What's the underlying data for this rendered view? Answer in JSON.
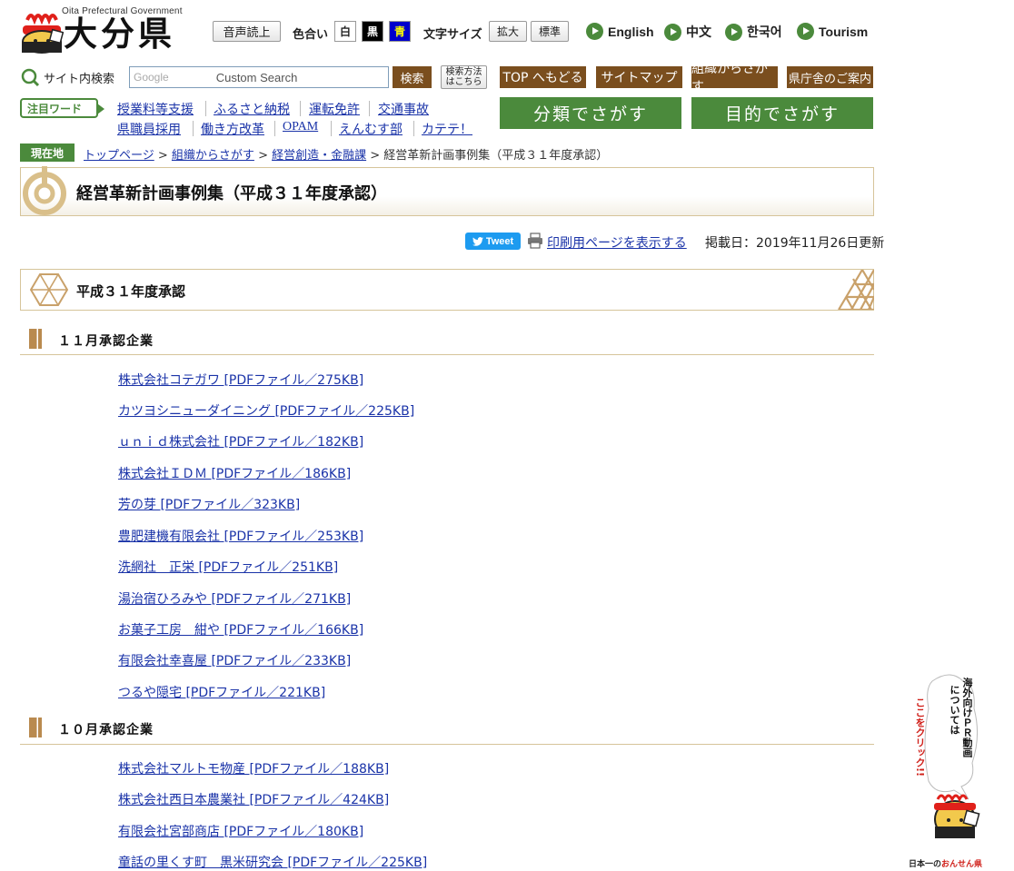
{
  "header": {
    "logo_en": "Oita Prefectural Government",
    "logo_jp": "大分県",
    "read_aloud": "音声読上",
    "color_label": "色合い",
    "colors": [
      {
        "label": "白",
        "bg": "#ffffff",
        "fg": "#222222"
      },
      {
        "label": "黒",
        "bg": "#000000",
        "fg": "#ffffff"
      },
      {
        "label": "青",
        "bg": "#0000cc",
        "fg": "#ffff00"
      }
    ],
    "fontsize_label": "文字サイズ",
    "enlarge": "拡大",
    "standard": "標準",
    "languages": [
      "English",
      "中文",
      "한국어",
      "Tourism"
    ]
  },
  "search": {
    "label": "サイト内検索",
    "placeholder_brand": "Google",
    "placeholder": "Custom Search",
    "button": "検索",
    "help_line1": "検索方法",
    "help_line2": "はこちら"
  },
  "nav": {
    "top": "TOP へもどる",
    "sitemap": "サイトマップ",
    "org": "組織からさがす",
    "office": "県庁舎のご案内",
    "browse_category": "分類でさがす",
    "browse_purpose": "目的でさがす"
  },
  "keywords": {
    "label": "注目ワード",
    "row1": [
      "授業料等支援",
      "ふるさと納税",
      "運転免許",
      "交通事故"
    ],
    "row2": [
      "県職員採用",
      "働き方改革",
      "OPAM",
      "えんむす部",
      "カテテ！"
    ]
  },
  "breadcrumb": {
    "label": "現在地",
    "items": [
      "トップページ",
      "組織からさがす",
      "経営創造・金融課"
    ],
    "current": "経営革新計画事例集（平成３１年度承認）",
    "sep": " > "
  },
  "page": {
    "title": "経営革新計画事例集（平成３１年度承認）",
    "tweet": "Tweet",
    "print": "印刷用ページを表示する",
    "published": "掲載日：2019年11月26日更新",
    "section_title": "平成３１年度承認"
  },
  "groups": [
    {
      "heading": "１１月承認企業",
      "links": [
        "株式会社コテガワ [PDFファイル／275KB]",
        "カツヨシニューダイニング [PDFファイル／225KB]",
        "ｕｎｉｄ株式会社 [PDFファイル／182KB]",
        "株式会社ＩＤＭ [PDFファイル／186KB]",
        "芳の芽 [PDFファイル／323KB]",
        "豊肥建機有限会社 [PDFファイル／253KB]",
        "洗網社　正栄 [PDFファイル／251KB]",
        "湯治宿ひろみや [PDFファイル／271KB]",
        "お菓子工房　紺や [PDFファイル／166KB]",
        "有限会社幸喜屋 [PDFファイル／233KB]",
        "つるや隠宅 [PDFファイル／221KB]"
      ]
    },
    {
      "heading": "１０月承認企業",
      "links": [
        "株式会社マルトモ物産 [PDFファイル／188KB]",
        "株式会社西日本農業社 [PDFファイル／424KB]",
        "有限会社宮部商店 [PDFファイル／180KB]",
        "童話の里くす町　黒米研究会 [PDFファイル／225KB]"
      ]
    }
  ],
  "promo": {
    "line1": "海外向けＰＲ動画",
    "line2": "については",
    "line3": "ここをクリック!!",
    "footer_a": "日本一の",
    "footer_b": "おんせん県"
  }
}
